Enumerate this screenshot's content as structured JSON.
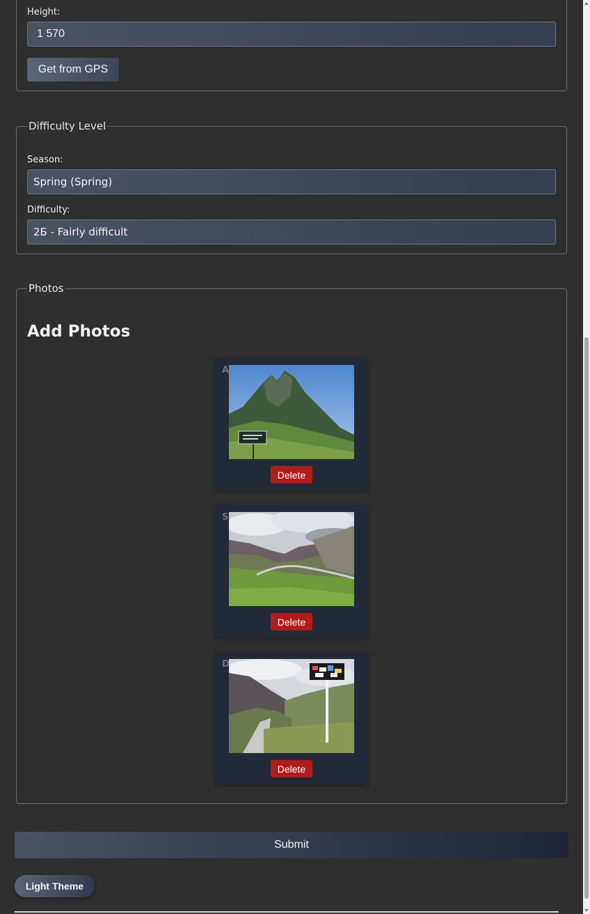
{
  "location": {
    "height_label": "Height:",
    "height_value": "1 570",
    "gps_button_label": "Get from GPS"
  },
  "difficulty": {
    "legend": "Difficulty Level",
    "season_label": "Season:",
    "season_value": "Spring (Spring)",
    "difficulty_label": "Difficulty:",
    "difficulty_value": "2Б - Fairly difficult"
  },
  "photos": {
    "legend": "Photos",
    "heading": "Add Photos",
    "items": [
      {
        "label": "Ascent",
        "delete_label": "Delete",
        "scene": "mountain-peak-sign"
      },
      {
        "label": "Saddle",
        "delete_label": "Delete",
        "scene": "valley-road"
      },
      {
        "label": "Descent",
        "delete_label": "Delete",
        "scene": "road-signpost"
      }
    ]
  },
  "form": {
    "submit_label": "Submit",
    "theme_toggle_label": "Light Theme"
  }
}
